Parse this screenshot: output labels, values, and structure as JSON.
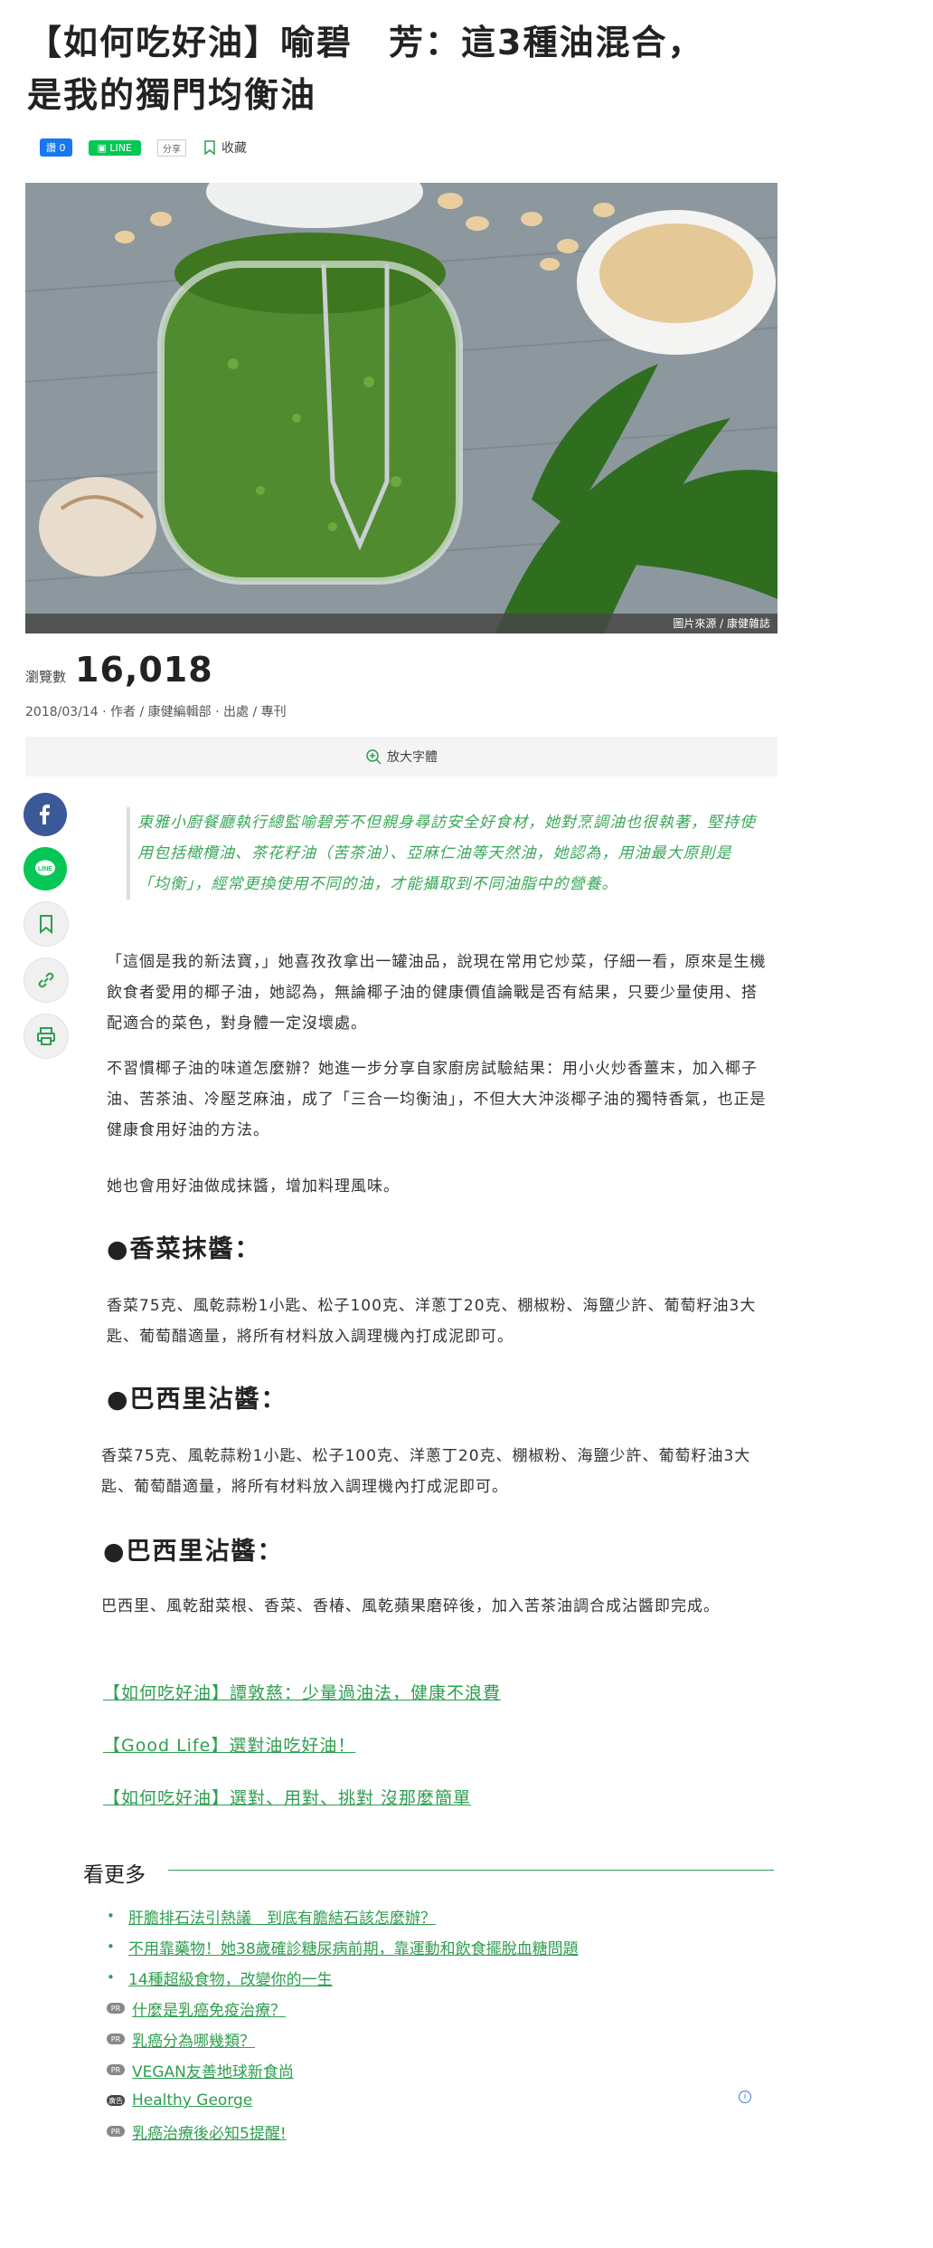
{
  "article": {
    "title_line1": "【如何吃好油】喻碧　芳：這3種油混合，",
    "title_line2": "是我的獨門均衡油",
    "share": {
      "like_label": "讚 0",
      "line_label": "",
      "share_label": "分享",
      "collect_label": "收藏"
    },
    "image_caption": "圖片來源 / 康健雜誌",
    "views_label": "瀏覽數",
    "views_count": "16,018",
    "meta": "2018/03/14 · 作者 / 康健編輯部 · 出處 / 專刊",
    "font_button": "放大字體",
    "quote": "東雅小廚餐廳執行總監喻碧芳不但親身尋訪安全好食材，她對烹調油也很執著，堅持使用包括橄欖油、茶花籽油（苦茶油）、亞麻仁油等天然油，她認為，用油最大原則是「均衡」，經常更換使用不同的油，才能攝取到不同油脂中的營養。",
    "paragraphs": [
      "「這個是我的新法寶，」她喜孜孜拿出一罐油品，說現在常用它炒菜，仔細一看，原來是生機飲食者愛用的椰子油，她認為，無論椰子油的健康價值論戰是否有結果，只要少量使用、搭配適合的菜色，對身體一定沒壞處。",
      "不習慣椰子油的味道怎麼辦？她進一步分享自家廚房試驗結果：用小火炒香薑末，加入椰子油、苦茶油、冷壓芝麻油，成了「三合一均衡油」，不但大大沖淡椰子油的獨特香氣，也正是健康食用好油的方法。",
      "她也會用好油做成抹醬，增加料理風味。"
    ],
    "sections": [
      {
        "heading": "●香菜抹醬：",
        "text": "香菜75克、風乾蒜粉1小匙、松子100克、洋蔥丁20克、棚椒粉、海鹽少許、葡萄籽油3大匙、葡萄醋適量，將所有材料放入調理機內打成泥即可。"
      },
      {
        "heading": "●巴西里沾醬：",
        "text": "香菜75克、風乾蒜粉1小匙、松子100克、洋蔥丁20克、棚椒粉、海鹽少許、葡萄籽油3大匙、葡萄醋適量，將所有材料放入調理機內打成泥即可。"
      },
      {
        "heading": "●巴西里沾醬：",
        "text": "巴西里、風乾甜菜根、香菜、香椿、風乾蘋果磨碎後，加入苦茶油調合成沾醬即完成。"
      }
    ],
    "related_links": [
      "【如何吃好油】譚敦慈：少量過油法，健康不浪費",
      "【Good Life】選對油吃好油！",
      "【如何吃好油】選對、用對、挑對 沒那麼簡單"
    ]
  },
  "more": {
    "title": "看更多",
    "items": [
      {
        "label": "肝膽排石法引熱議　到底有膽結石該怎麼辦？",
        "badge": ""
      },
      {
        "label": "不用靠藥物！她38歲確診糖尿病前期，靠運動和飲食擺脫血糖問題",
        "badge": ""
      },
      {
        "label": "14種超級食物，改變你的一生",
        "badge": ""
      },
      {
        "label": "什麼是乳癌免疫治療？",
        "badge": "PR"
      },
      {
        "label": "乳癌分為哪幾類？",
        "badge": "PR"
      },
      {
        "label": "VEGAN友善地球新食尚",
        "badge": "PR"
      },
      {
        "label": "Healthy George",
        "badge": "廣告"
      },
      {
        "label": "乳癌治療後必知5提醒!",
        "badge": "PR"
      }
    ]
  },
  "colors": {
    "accent": "#2e9e4f",
    "quote": "#3aa859",
    "facebook": "#3b5998",
    "line": "#06c755"
  }
}
